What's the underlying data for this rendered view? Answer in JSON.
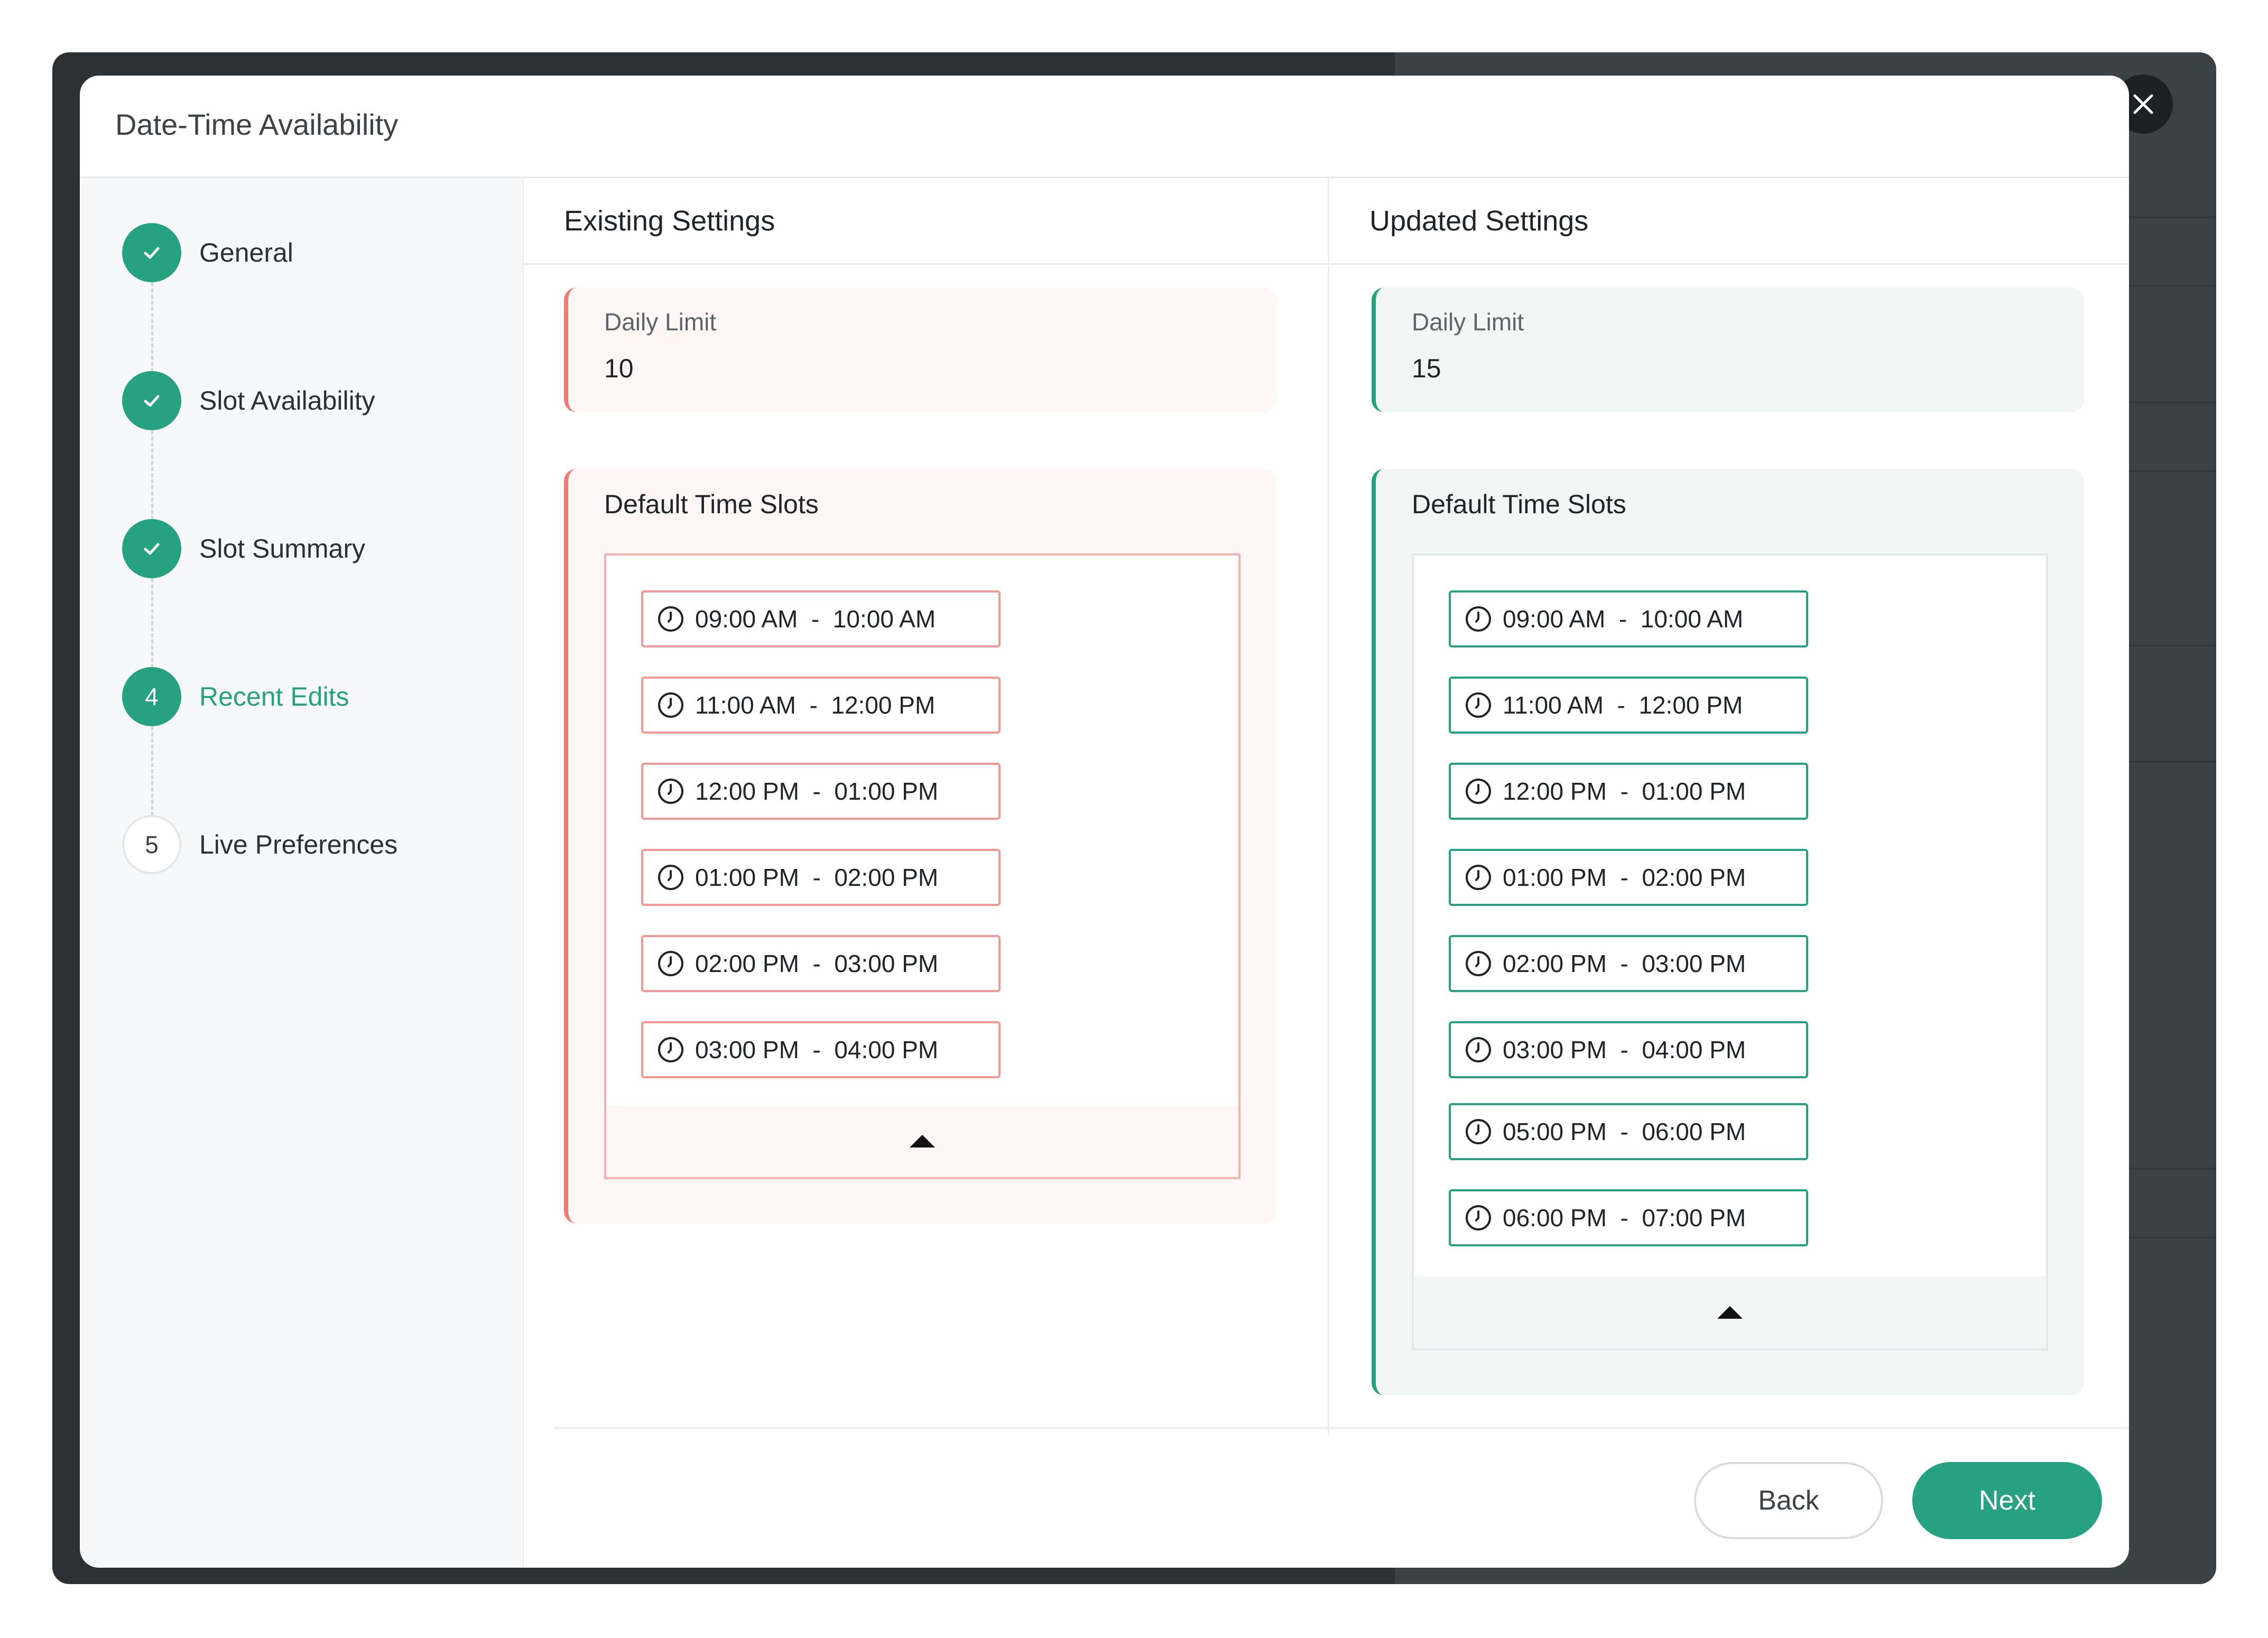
{
  "modal": {
    "title": "Date-Time Availability"
  },
  "stepper": {
    "steps": [
      {
        "marker": "",
        "label": "General",
        "state": "done"
      },
      {
        "marker": "",
        "label": "Slot Availability",
        "state": "done"
      },
      {
        "marker": "",
        "label": "Slot Summary",
        "state": "done"
      },
      {
        "marker": "4",
        "label": "Recent Edits",
        "state": "active"
      },
      {
        "marker": "5",
        "label": "Live Preferences",
        "state": "pending"
      }
    ]
  },
  "existing": {
    "heading": "Existing Settings",
    "daily_limit_label": "Daily Limit",
    "daily_limit_value": "10",
    "slots_title": "Default Time Slots",
    "slots": [
      "09:00 AM  -  10:00 AM",
      "11:00 AM  -  12:00 PM",
      "12:00 PM  -  01:00 PM",
      "01:00 PM  -  02:00 PM",
      "02:00 PM  -  03:00 PM",
      "03:00 PM  -  04:00 PM"
    ]
  },
  "updated": {
    "heading": "Updated Settings",
    "daily_limit_label": "Daily Limit",
    "daily_limit_value": "15",
    "slots_title": "Default Time Slots",
    "slots": [
      "09:00 AM  -  10:00 AM",
      "11:00 AM  -  12:00 PM",
      "12:00 PM  -  01:00 PM",
      "01:00 PM  -  02:00 PM",
      "02:00 PM  -  03:00 PM",
      "03:00 PM  -  04:00 PM",
      "05:00 PM  -  06:00 PM",
      "06:00 PM  -  07:00 PM"
    ]
  },
  "footer": {
    "back_label": "Back",
    "next_label": "Next"
  },
  "colors": {
    "accent": "#26a283",
    "removed": "#f07a75",
    "backdrop": "#2b3135"
  },
  "icons": {
    "close": "close-icon",
    "done": "check-icon",
    "slot": "clock-icon",
    "collapse": "caret-up-icon"
  }
}
